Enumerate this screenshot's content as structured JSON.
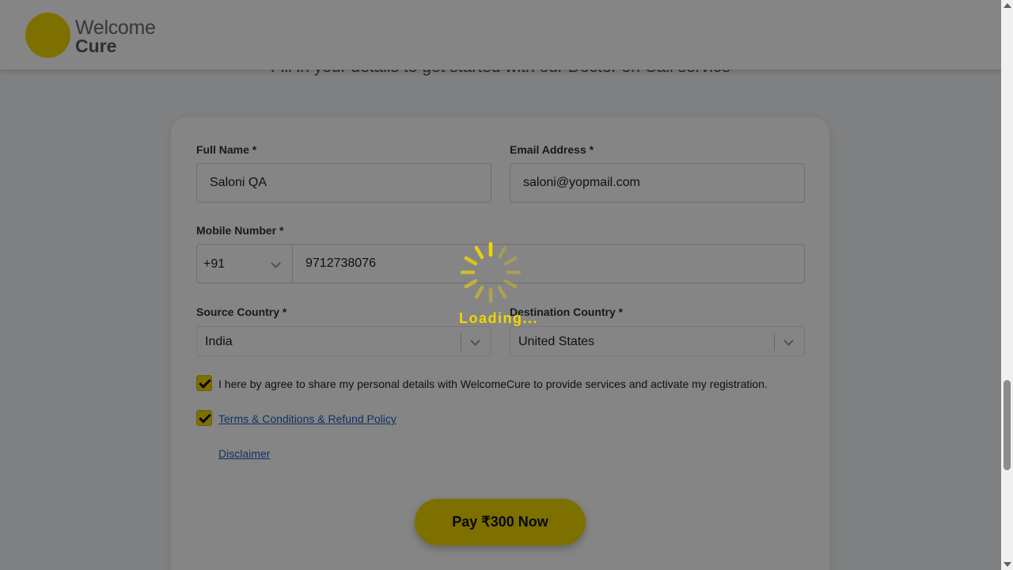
{
  "header": {
    "logo_line1": "Welcome",
    "logo_line2": "Cure"
  },
  "subtitle": "Fill in your details to get started with our Doctor on Call service",
  "form": {
    "full_name_label": "Full Name *",
    "full_name_value": "Saloni QA",
    "email_label": "Email Address *",
    "email_value": "saloni@yopmail.com",
    "mobile_label": "Mobile Number *",
    "country_code": "+91",
    "mobile_value": "9712738076",
    "source_label": "Source Country *",
    "source_value": "India",
    "destination_label": "Destination Country *",
    "destination_value": "United States",
    "consent_text": "I here by agree to share my personal details with WelcomeCure to provide services and activate my registration.",
    "consent_checked": true,
    "terms_link": "Terms & Conditions & Refund Policy",
    "terms_checked": true,
    "disclaimer_link": "Disclaimer",
    "pay_button": "Pay ₹300 Now"
  },
  "loading": {
    "text": "Loading..."
  },
  "colors": {
    "brand_yellow": "#f2d600",
    "link_blue": "#1f5fbf",
    "overlay": "rgba(0,0,0,0.48)"
  }
}
